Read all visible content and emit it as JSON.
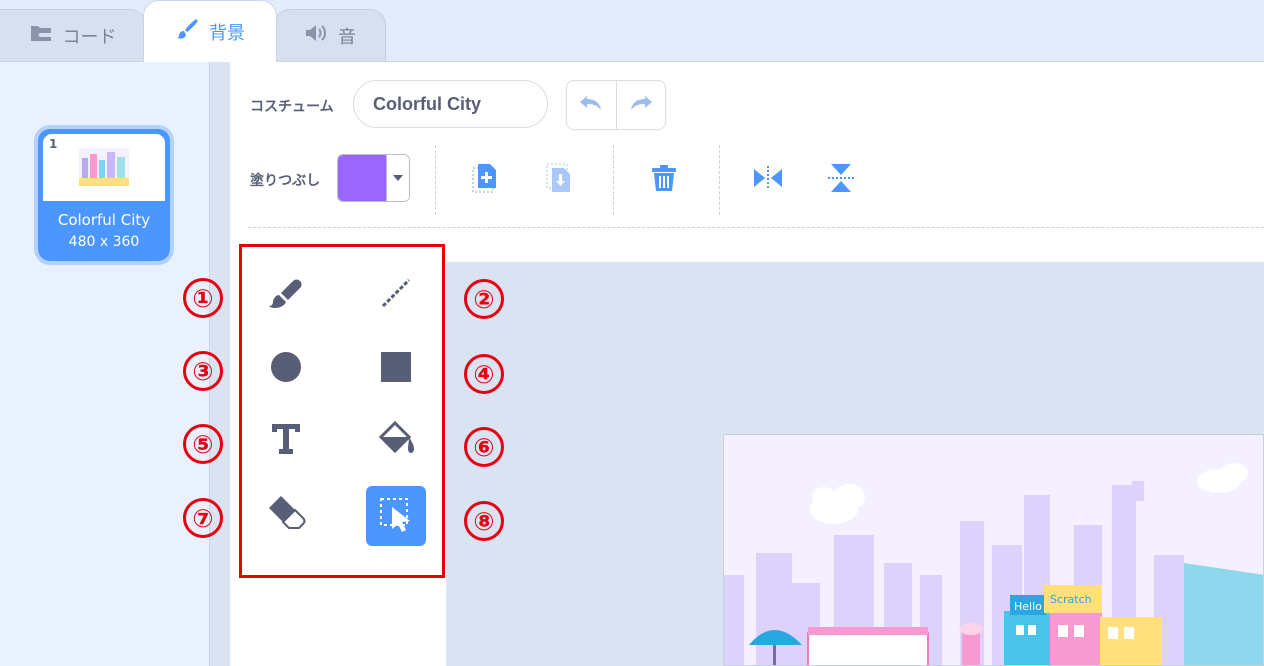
{
  "tabs": {
    "code": "コード",
    "backdrop": "背景",
    "sound": "音"
  },
  "sprite_list": {
    "item": {
      "number": "1",
      "name": "Colorful City",
      "size": "480 x 360"
    }
  },
  "editor": {
    "costume_label": "コスチューム",
    "costume_name": "Colorful City",
    "fill_label": "塗りつぶし",
    "fill_color": "#9966ff"
  },
  "annotations": [
    "①",
    "②",
    "③",
    "④",
    "⑤",
    "⑥",
    "⑦",
    "⑧"
  ],
  "tools": [
    "brush",
    "line",
    "circle",
    "rectangle",
    "text",
    "fill",
    "eraser",
    "select"
  ],
  "active_tool": "select",
  "colors": {
    "accent": "#4c97ff",
    "annotation_red": "#e50012",
    "tool_icon": "#575e75"
  }
}
